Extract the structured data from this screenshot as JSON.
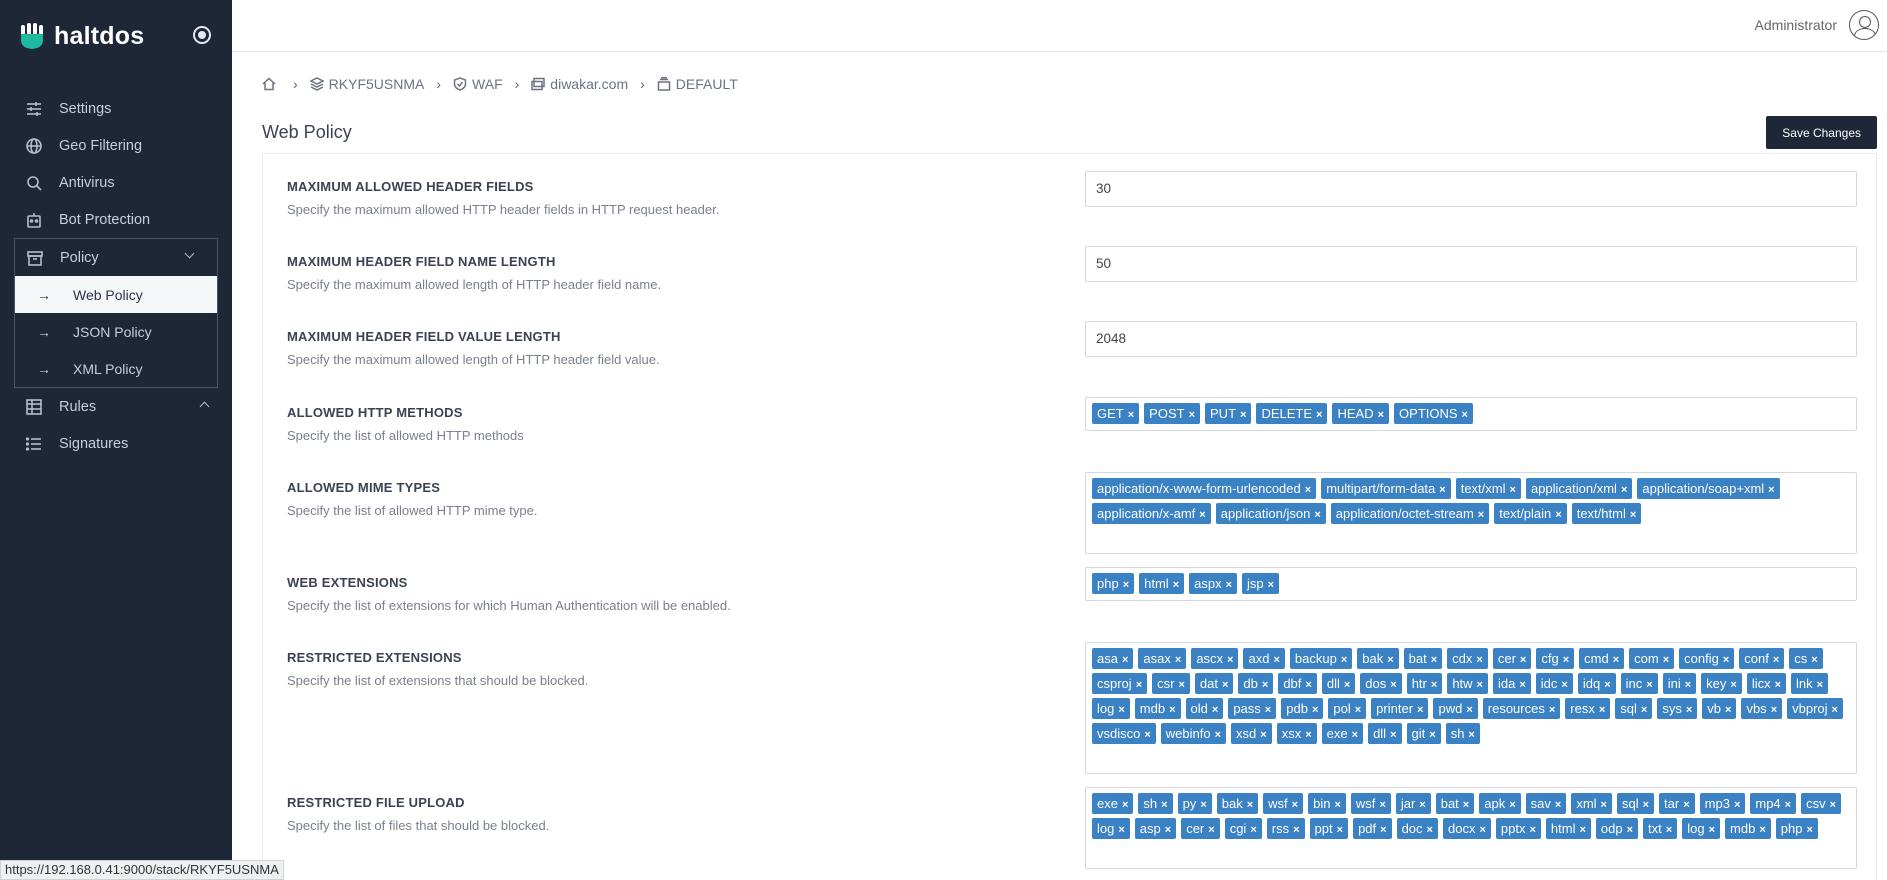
{
  "brand": {
    "name": "haltdos"
  },
  "sidebar": {
    "items": [
      {
        "label": "Settings",
        "icon": "sliders-icon"
      },
      {
        "label": "Geo Filtering",
        "icon": "globe-icon"
      },
      {
        "label": "Antivirus",
        "icon": "search-icon"
      },
      {
        "label": "Bot Protection",
        "icon": "robot-icon"
      }
    ],
    "policy": {
      "label": "Policy",
      "icon": "archive-icon",
      "children": [
        {
          "label": "Web Policy",
          "active": true
        },
        {
          "label": "JSON Policy"
        },
        {
          "label": "XML Policy"
        }
      ]
    },
    "rules": {
      "label": "Rules",
      "icon": "table-icon"
    },
    "signatures": {
      "label": "Signatures",
      "icon": "list-icon"
    }
  },
  "header": {
    "user": "Administrator"
  },
  "breadcrumb": {
    "stack": "RKYF5USNMA",
    "waf": "WAF",
    "domain": "diwakar.com",
    "profile": "DEFAULT"
  },
  "page": {
    "title": "Web Policy",
    "save_label": "Save Changes"
  },
  "fields": {
    "max_header_fields": {
      "label": "MAXIMUM ALLOWED HEADER FIELDS",
      "desc": "Specify the maximum allowed HTTP header fields in HTTP request header.",
      "value": "30"
    },
    "max_name_length": {
      "label": "MAXIMUM HEADER FIELD NAME LENGTH",
      "desc": "Specify the maximum allowed length of HTTP header field name.",
      "value": "50"
    },
    "max_value_length": {
      "label": "MAXIMUM HEADER FIELD VALUE LENGTH",
      "desc": "Specify the maximum allowed length of HTTP header field value.",
      "value": "2048"
    },
    "http_methods": {
      "label": "ALLOWED HTTP METHODS",
      "desc": "Specify the list of allowed HTTP methods",
      "tags": [
        "GET",
        "POST",
        "PUT",
        "DELETE",
        "HEAD",
        "OPTIONS"
      ]
    },
    "mime_types": {
      "label": "ALLOWED MIME TYPES",
      "desc": "Specify the list of allowed HTTP mime type.",
      "tags": [
        "application/x-www-form-urlencoded",
        "multipart/form-data",
        "text/xml",
        "application/xml",
        "application/soap+xml",
        "application/x-amf",
        "application/json",
        "application/octet-stream",
        "text/plain",
        "text/html"
      ]
    },
    "web_extensions": {
      "label": "WEB EXTENSIONS",
      "desc": "Specify the list of extensions for which Human Authentication will be enabled.",
      "tags": [
        "php",
        "html",
        "aspx",
        "jsp"
      ]
    },
    "restricted_extensions": {
      "label": "RESTRICTED EXTENSIONS",
      "desc": "Specify the list of extensions that should be blocked.",
      "tags": [
        "asa",
        "asax",
        "ascx",
        "axd",
        "backup",
        "bak",
        "bat",
        "cdx",
        "cer",
        "cfg",
        "cmd",
        "com",
        "config",
        "conf",
        "cs",
        "csproj",
        "csr",
        "dat",
        "db",
        "dbf",
        "dll",
        "dos",
        "htr",
        "htw",
        "ida",
        "idc",
        "idq",
        "inc",
        "ini",
        "key",
        "licx",
        "lnk",
        "log",
        "mdb",
        "old",
        "pass",
        "pdb",
        "pol",
        "printer",
        "pwd",
        "resources",
        "resx",
        "sql",
        "sys",
        "vb",
        "vbs",
        "vbproj",
        "vsdisco",
        "webinfo",
        "xsd",
        "xsx",
        "exe",
        "dll",
        "git",
        "sh"
      ]
    },
    "restricted_upload": {
      "label": "RESTRICTED FILE UPLOAD",
      "desc": "Specify the list of files that should be blocked.",
      "tags": [
        "exe",
        "sh",
        "py",
        "bak",
        "wsf",
        "bin",
        "wsf",
        "jar",
        "bat",
        "apk",
        "sav",
        "xml",
        "sql",
        "tar",
        "mp3",
        "mp4",
        "csv",
        "log",
        "asp",
        "cer",
        "cgi",
        "rss",
        "ppt",
        "pdf",
        "doc",
        "docx",
        "pptx",
        "html",
        "odp",
        "txt",
        "log",
        "mdb",
        "php"
      ]
    }
  },
  "status_bar": {
    "url": "https://192.168.0.41:9000/stack/RKYF5USNMA"
  },
  "colors": {
    "sidebar_bg": "#1d2738",
    "tag_bg": "#3b82c4",
    "button_bg": "#1d2738"
  }
}
